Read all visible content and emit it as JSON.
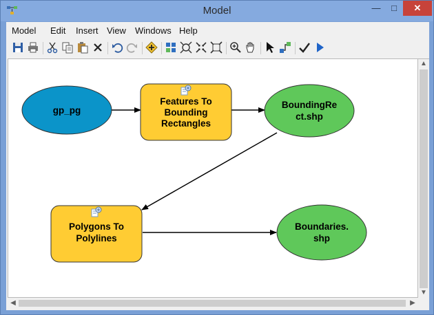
{
  "window": {
    "title": "Model"
  },
  "menu": [
    "Model",
    "Edit",
    "Insert",
    "View",
    "Windows",
    "Help"
  ],
  "toolbar": [
    {
      "icon": "save-icon"
    },
    {
      "icon": "print-icon"
    },
    {
      "icon": "cut-icon"
    },
    {
      "icon": "copy-icon"
    },
    {
      "icon": "paste-icon"
    },
    {
      "icon": "delete-icon"
    },
    {
      "icon": "undo-icon"
    },
    {
      "icon": "redo-icon"
    },
    {
      "icon": "add-data-icon"
    },
    {
      "icon": "auto-layout-icon"
    },
    {
      "icon": "full-extent-icon"
    },
    {
      "icon": "fixed-zoom-in-icon"
    },
    {
      "icon": "fixed-zoom-out-icon"
    },
    {
      "icon": "zoom-in-icon"
    },
    {
      "icon": "pan-icon"
    },
    {
      "icon": "select-icon"
    },
    {
      "icon": "connect-icon"
    },
    {
      "icon": "validate-icon"
    },
    {
      "icon": "run-icon"
    }
  ],
  "model": {
    "nodes": {
      "gp_pg": {
        "lines": [
          "gp_pg"
        ],
        "shape": "ellipse",
        "color": "#0b94c9"
      },
      "features_to_bounding": {
        "lines": [
          "Features To",
          "Bounding",
          "Rectangles"
        ],
        "shape": "tool",
        "color": "#ffcc33"
      },
      "bounding_rect_shp": {
        "lines": [
          "BoundingRe",
          "ct.shp"
        ],
        "shape": "ellipse",
        "color": "#5fc85a"
      },
      "polygons_to_polylines": {
        "lines": [
          "Polygons To",
          "Polylines"
        ],
        "shape": "tool",
        "color": "#ffcc33"
      },
      "boundaries_shp": {
        "lines": [
          "Boundaries.",
          "shp"
        ],
        "shape": "ellipse",
        "color": "#5fc85a"
      }
    },
    "connections": [
      {
        "from": "gp_pg",
        "to": "features_to_bounding"
      },
      {
        "from": "features_to_bounding",
        "to": "bounding_rect_shp"
      },
      {
        "from": "bounding_rect_shp",
        "to": "polygons_to_polylines"
      },
      {
        "from": "polygons_to_polylines",
        "to": "boundaries_shp"
      }
    ]
  }
}
